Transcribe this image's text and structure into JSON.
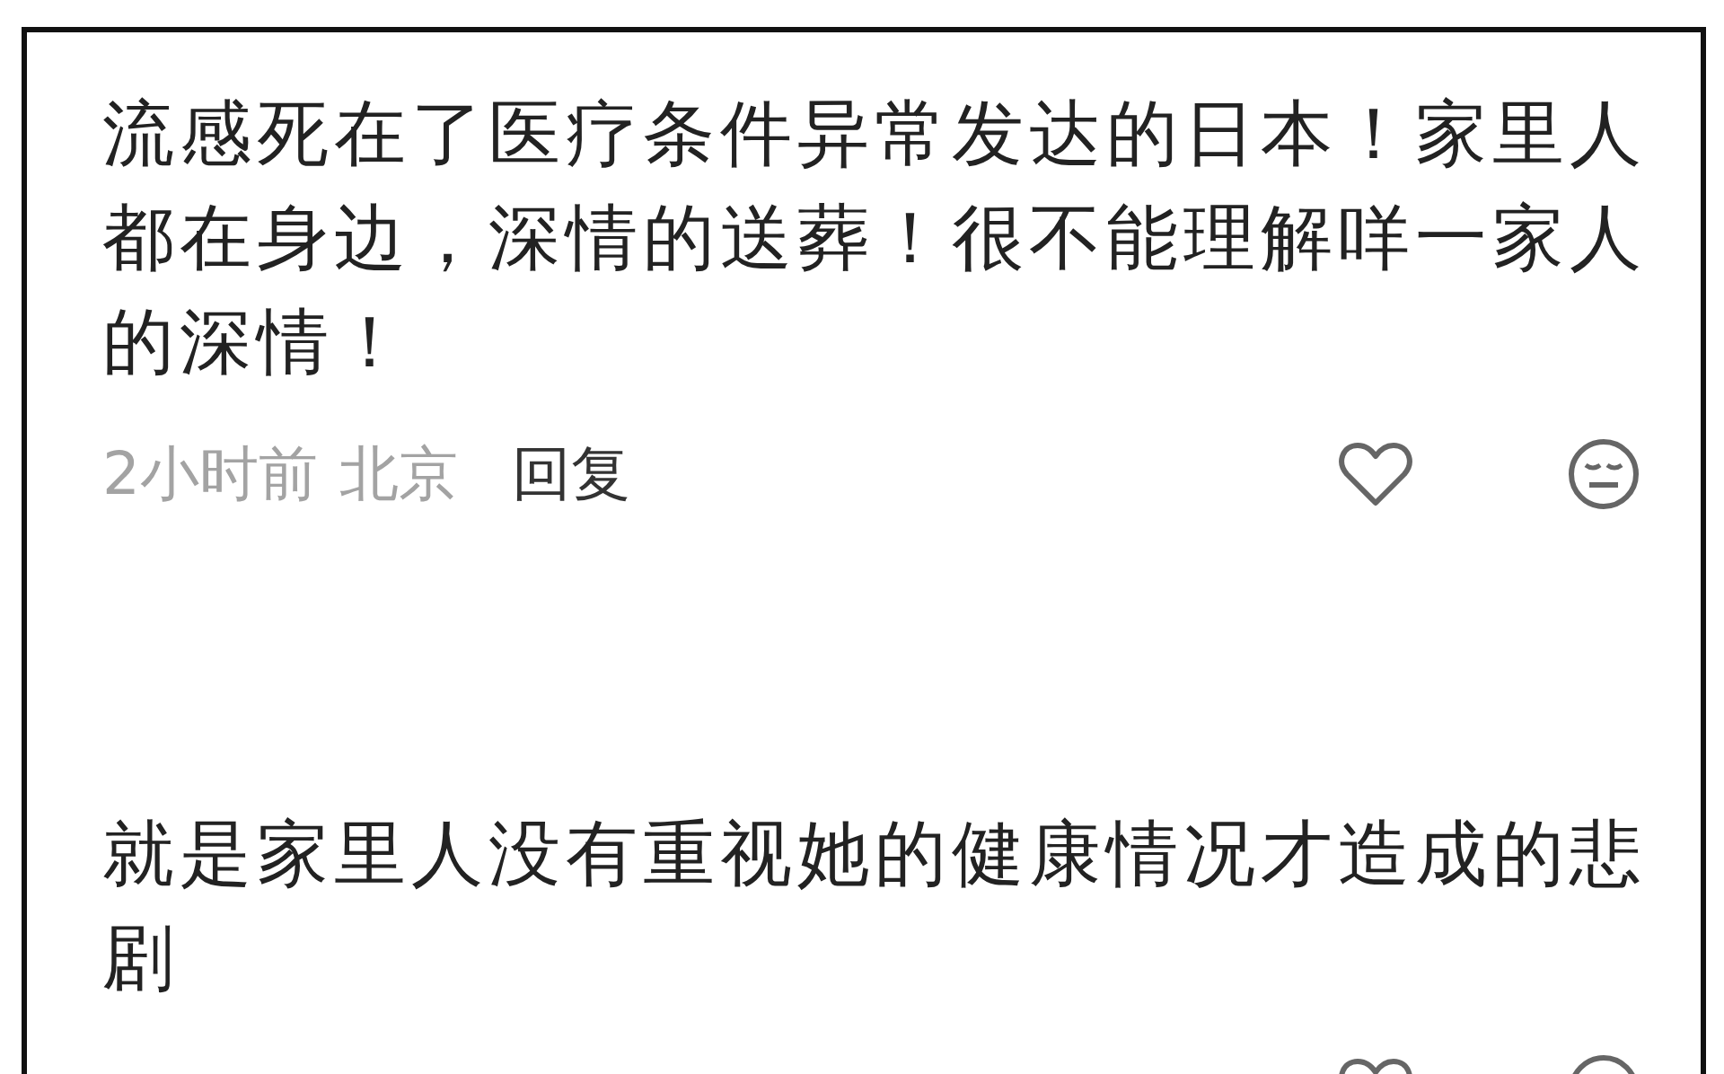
{
  "comments": [
    {
      "text": "流感死在了医疗条件异常发达的日本！家里人都在身边，深情的送葬！很不能理解咩一家人的深情！",
      "time": "2小时前",
      "location": "北京",
      "reply": "回复",
      "liked": false
    },
    {
      "text": "就是家里人没有重视她的健康情况才造成的悲剧",
      "liked": false
    }
  ]
}
